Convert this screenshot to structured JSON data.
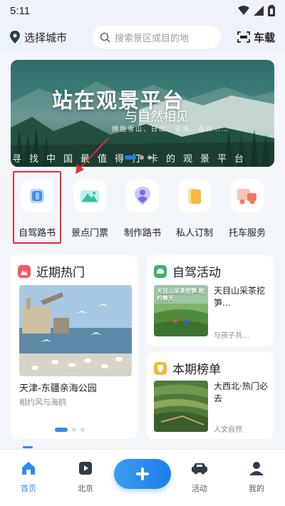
{
  "status_bar": {
    "time": "5:11"
  },
  "header": {
    "city_label": "选择城市",
    "search_placeholder": "搜索景区或目的地",
    "car_link_label": "车载"
  },
  "banner": {
    "title": "站在观景平台",
    "subtitle": "与自然相见",
    "tags": "拥抱雪山、日出、云海、森林……",
    "strip_text": "寻找中国最值得打卡的观景平台"
  },
  "quick_menu": [
    {
      "label": "自驾路书",
      "icon": "book-icon",
      "color": "#3d8ef0"
    },
    {
      "label": "景点门票",
      "icon": "mountain-icon",
      "color": "#2ec3a3"
    },
    {
      "label": "制作路书",
      "icon": "person-pin-icon",
      "color": "#6d6ef0"
    },
    {
      "label": "私人订制",
      "icon": "folder-icon",
      "color": "#f6b73c"
    },
    {
      "label": "托车服务",
      "icon": "truck-icon",
      "color": "#f4775a"
    }
  ],
  "hot_section": {
    "title": "近期热门",
    "item_title": "天津-东疆亲海公园",
    "item_subtitle": "相约风与海鸥"
  },
  "drive_section": {
    "title": "自驾活动",
    "item_title": "天目山采茶挖笋…",
    "item_subtitle": "与孩子共…",
    "thumb_caption": "天目山采茶挖笋 相约春天"
  },
  "rank_section": {
    "title": "本期榜单",
    "item_title": "大西北·热门必去",
    "item_subtitle": "人文自然"
  },
  "tabbar": {
    "home": "首页",
    "city": "北京",
    "activity": "活动",
    "mine": "我的"
  },
  "colors": {
    "accent": "#2d8cf0",
    "highlight": "#e33030"
  }
}
